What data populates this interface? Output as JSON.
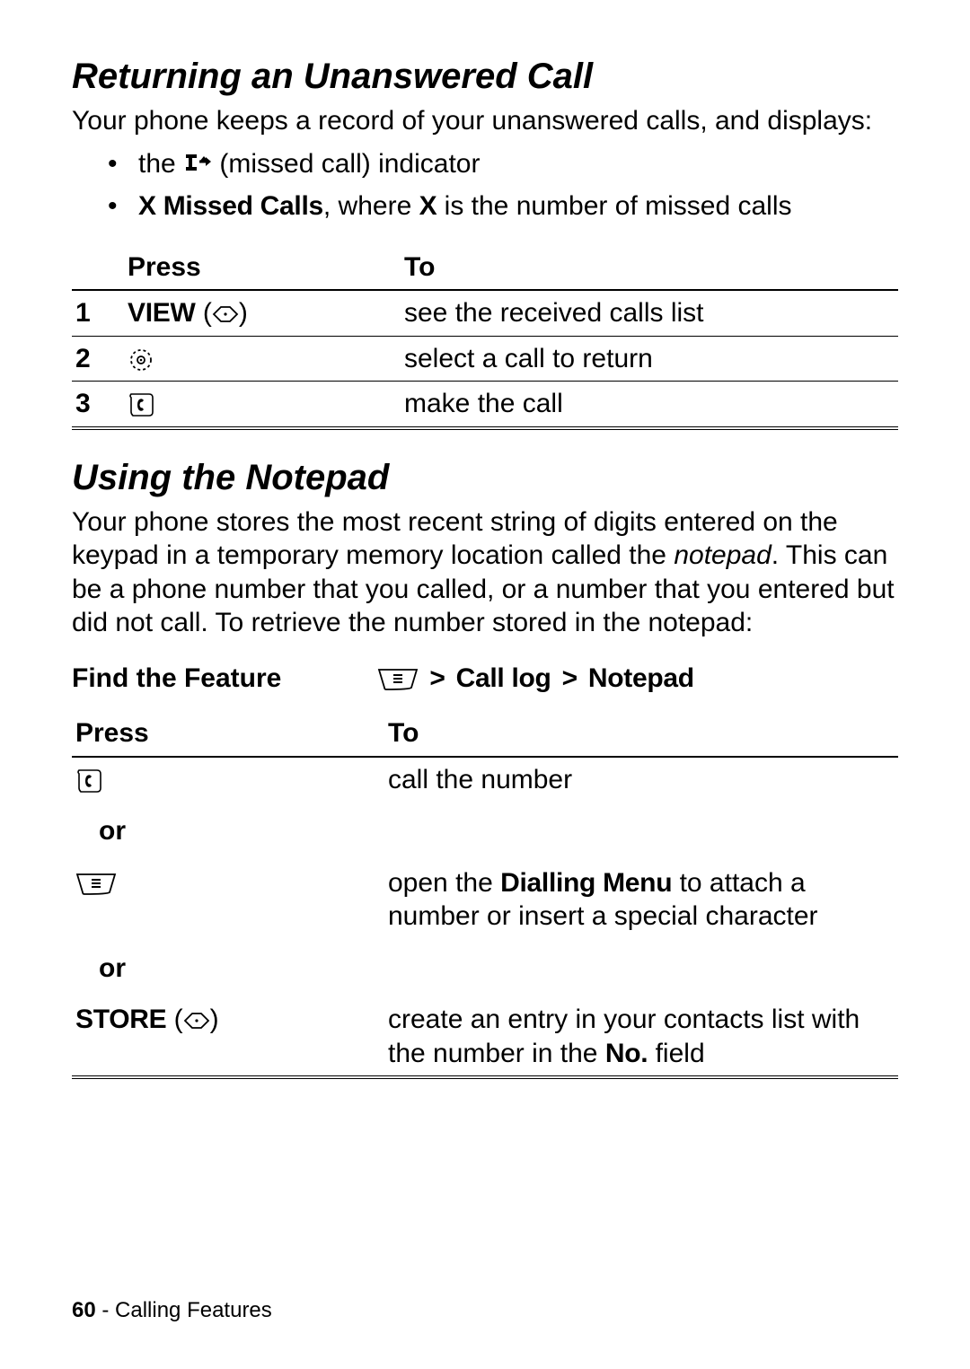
{
  "section1": {
    "heading": "Returning an Unanswered Call",
    "intro": "Your phone keeps a record of your unanswered calls, and displays:",
    "bullet1_prefix": "the ",
    "bullet1_suffix": " (missed call) indicator",
    "bullet2_prefix": "X Missed Calls",
    "bullet2_mid": ", where ",
    "bullet2_x": "X",
    "bullet2_suffix": " is the number of missed calls"
  },
  "table1": {
    "head_step": "",
    "head_press": "Press",
    "head_to": "To",
    "rows": [
      {
        "step": "1",
        "press_label": "VIEW",
        "to": "see the received calls list"
      },
      {
        "step": "2",
        "press_label": "",
        "to": "select a call to return"
      },
      {
        "step": "3",
        "press_label": "",
        "to": "make the call"
      }
    ]
  },
  "section2": {
    "heading": "Using the Notepad",
    "body_pre": "Your phone stores the most recent string of digits entered on the keypad in a temporary memory location called the ",
    "body_em": "notepad",
    "body_post": ". This can be a phone number that you called, or a number that you entered but did not call. To retrieve the number stored in the notepad:"
  },
  "ftf": {
    "label": "Find the Feature",
    "sep1": " > ",
    "part1": "Call log",
    "sep2": " > ",
    "part2": "Notepad"
  },
  "table2": {
    "head_press": "Press",
    "head_to": "To",
    "row1_to": "call the number",
    "or": "or",
    "row2_to_pre": "open the ",
    "row2_to_bold": "Dialling Menu",
    "row2_to_post": " to attach a number or insert a special character",
    "row3_press_label": "STORE",
    "row3_to_pre": "create an entry in your contacts list with the number in the ",
    "row3_to_bold": "No.",
    "row3_to_post": " field"
  },
  "footer": {
    "page": "60",
    "sep": " - ",
    "chapter": "Calling Features"
  }
}
